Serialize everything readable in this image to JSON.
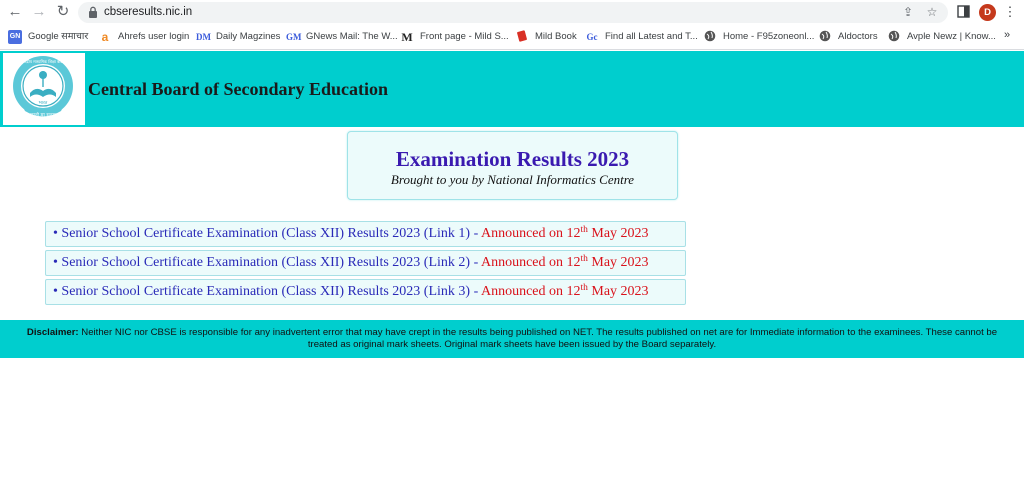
{
  "browser": {
    "url": "cbseresults.nic.in",
    "avatar_letter": "D",
    "bookmarks": [
      {
        "label": "Google समाचार",
        "icon": "google-news-icon",
        "glyph": "G",
        "color": "#4a6ee0"
      },
      {
        "label": "Ahrefs user login",
        "icon": "ahrefs-icon",
        "glyph": "a",
        "color": "#f08a24"
      },
      {
        "label": "Daily Magzines",
        "icon": "dm-icon",
        "glyph": "DM",
        "color": "#3b5bdb"
      },
      {
        "label": "GNews Mail: The W...",
        "icon": "gm-icon",
        "glyph": "GM",
        "color": "#3b5bdb"
      },
      {
        "label": "Front page - Mild S...",
        "icon": "m-icon",
        "glyph": "M",
        "color": "#222222"
      },
      {
        "label": "Mild Book",
        "icon": "book-icon",
        "glyph": "📕",
        "color": "#d93025"
      },
      {
        "label": "Find all Latest and T...",
        "icon": "gc-icon",
        "glyph": "Gc",
        "color": "#3b5bdb"
      },
      {
        "label": "Home - F95zoneonl...",
        "icon": "globe-icon",
        "glyph": "◉",
        "color": "#555555"
      },
      {
        "label": "Aldoctors",
        "icon": "globe-icon",
        "glyph": "◉",
        "color": "#555555"
      },
      {
        "label": "Avple Newz | Know...",
        "icon": "globe-icon",
        "glyph": "◉",
        "color": "#555555"
      }
    ]
  },
  "header": {
    "title": "Central Board of Secondary Education",
    "logo_top_text": "केंद्रीय माध्यमिक शिक्षा बोर्ड",
    "logo_mid_text": "भारत",
    "logo_bottom_text": "असतो मा सद्गमय"
  },
  "exam": {
    "title": "Examination Results 2023",
    "subtitle": "Brought to you by National Informatics Centre"
  },
  "results": [
    {
      "bullet": "•",
      "text": "Senior School Certificate Examination (Class XII) Results 2023 (Link 1)",
      "sep": " - ",
      "status_pre": "Announced on 12",
      "status_sup": "th",
      "status_post": " May 2023"
    },
    {
      "bullet": "•",
      "text": "Senior School Certificate Examination (Class XII) Results 2023 (Link 2)",
      "sep": " - ",
      "status_pre": "Announced on 12",
      "status_sup": "th",
      "status_post": " May 2023"
    },
    {
      "bullet": "•",
      "text": "Senior School Certificate Examination (Class XII) Results 2023 (Link 3)",
      "sep": " - ",
      "status_pre": "Announced on 12",
      "status_sup": "th",
      "status_post": " May 2023"
    }
  ],
  "disclaimer": {
    "label": "Disclaimer:",
    "text": " Neither NIC nor CBSE is responsible for any inadvertent error that may have crept in the results being published on NET. The results published on net are for Immediate information to the examinees. These cannot be treated as original mark sheets. Original mark sheets have been issued by the Board separately."
  }
}
